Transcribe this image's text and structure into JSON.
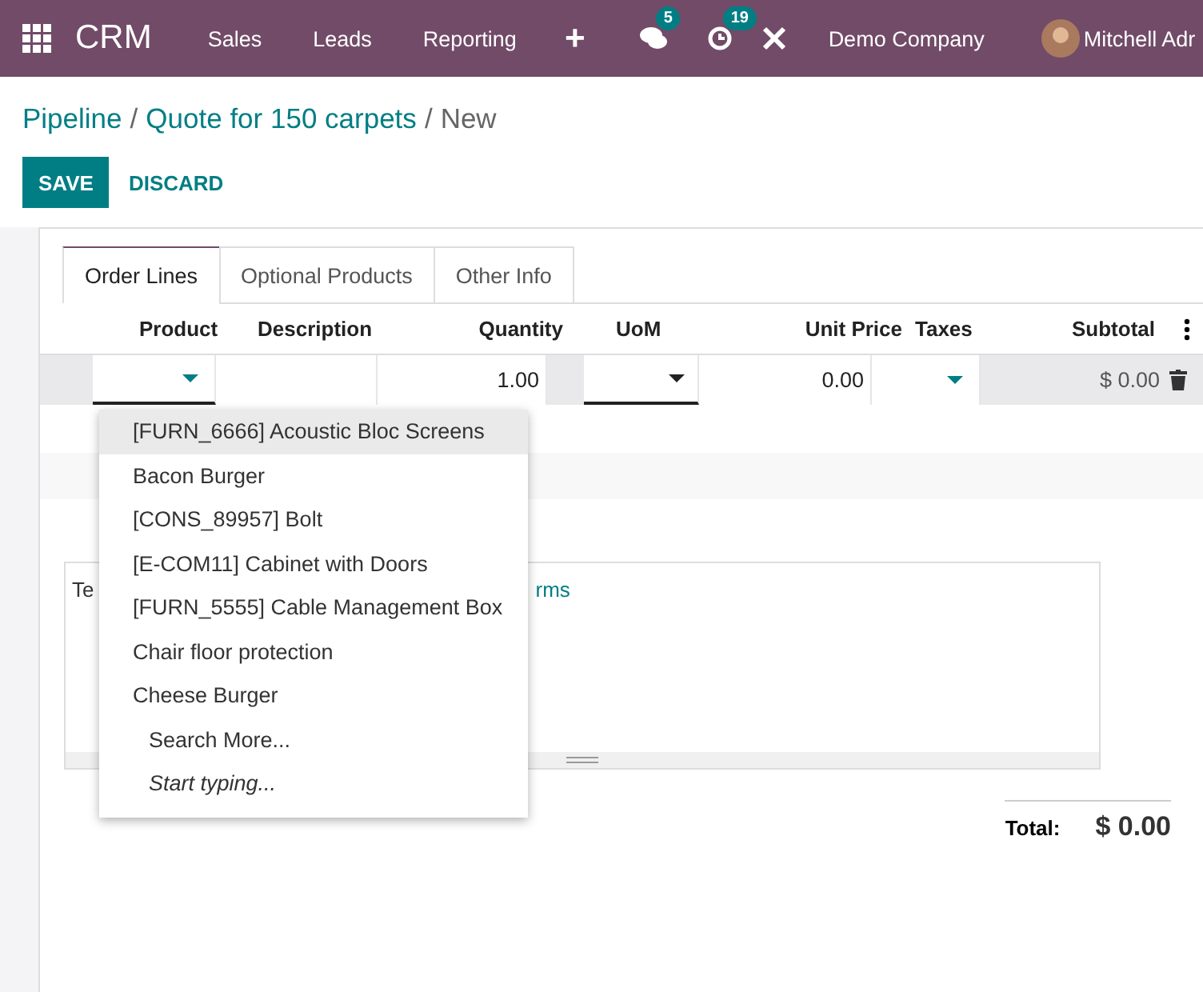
{
  "navbar": {
    "app": "CRM",
    "menu": [
      "Sales",
      "Leads",
      "Reporting"
    ],
    "add": "+",
    "messages_count": "5",
    "activities_count": "19",
    "company": "Demo Company",
    "user": "Mitchell Adr"
  },
  "breadcrumb": {
    "links": [
      "Pipeline",
      "Quote for 150 carpets"
    ],
    "separator": "/",
    "current": "New"
  },
  "buttons": {
    "save": "SAVE",
    "discard": "DISCARD"
  },
  "tabs": [
    {
      "label": "Order Lines",
      "selected": true
    },
    {
      "label": "Optional Products",
      "selected": false
    },
    {
      "label": "Other Info",
      "selected": false
    }
  ],
  "table": {
    "columns": [
      "Product",
      "Description",
      "Quantity",
      "UoM",
      "Unit Price",
      "Taxes",
      "Subtotal"
    ],
    "row": {
      "quantity": "1.00",
      "unit_price": "0.00",
      "subtotal": "$ 0.00"
    }
  },
  "terms": {
    "visible_start": "Te",
    "visible_link_end": "rms"
  },
  "dropdown": {
    "items": [
      {
        "label": "[FURN_6666] Acoustic Bloc Screens",
        "selected": true,
        "kind": "product"
      },
      {
        "label": "Bacon Burger",
        "selected": false,
        "kind": "product"
      },
      {
        "label": "[CONS_89957] Bolt",
        "selected": false,
        "kind": "product"
      },
      {
        "label": "[E-COM11] Cabinet with Doors",
        "selected": false,
        "kind": "product"
      },
      {
        "label": "[FURN_5555] Cable Management Box",
        "selected": false,
        "kind": "product"
      },
      {
        "label": "Chair floor protection",
        "selected": false,
        "kind": "product"
      },
      {
        "label": "Cheese Burger",
        "selected": false,
        "kind": "product"
      },
      {
        "label": "Search More...",
        "selected": false,
        "kind": "action"
      },
      {
        "label": "Start typing...",
        "selected": false,
        "kind": "hint"
      }
    ]
  },
  "total": {
    "label": "Total:",
    "value": "$ 0.00"
  }
}
